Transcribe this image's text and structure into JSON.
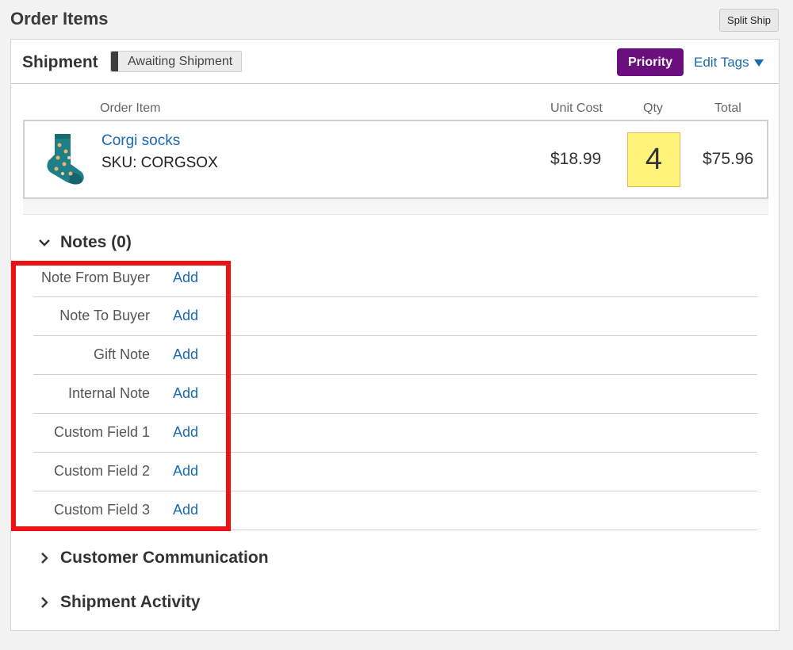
{
  "page": {
    "title": "Order Items",
    "split_ship_label": "Split Ship"
  },
  "shipment": {
    "title": "Shipment",
    "status": "Awaiting Shipment",
    "tag": {
      "label": "Priority",
      "color": "#6b0f7f"
    },
    "edit_tags_label": "Edit Tags"
  },
  "items_table": {
    "columns": [
      "Order Item",
      "Unit Cost",
      "Qty",
      "Total"
    ],
    "rows": [
      {
        "name": "Corgi socks",
        "sku": "SKU: CORGSOX",
        "unit_cost": "$18.99",
        "qty": "4",
        "total": "$75.96",
        "image": "sock-icon"
      }
    ]
  },
  "notes": {
    "title": "Notes (0)",
    "rows": [
      {
        "label": "Note From Buyer",
        "action": "Add"
      },
      {
        "label": "Note To Buyer",
        "action": "Add"
      },
      {
        "label": "Gift Note",
        "action": "Add"
      },
      {
        "label": "Internal Note",
        "action": "Add"
      },
      {
        "label": "Custom Field 1",
        "action": "Add"
      },
      {
        "label": "Custom Field 2",
        "action": "Add"
      },
      {
        "label": "Custom Field 3",
        "action": "Add"
      }
    ]
  },
  "sections": {
    "customer_communication": "Customer Communication",
    "shipment_activity": "Shipment Activity"
  },
  "colors": {
    "link": "#1a6ab3",
    "highlight": "#ee1111",
    "qty_bg": "#fff37a"
  }
}
